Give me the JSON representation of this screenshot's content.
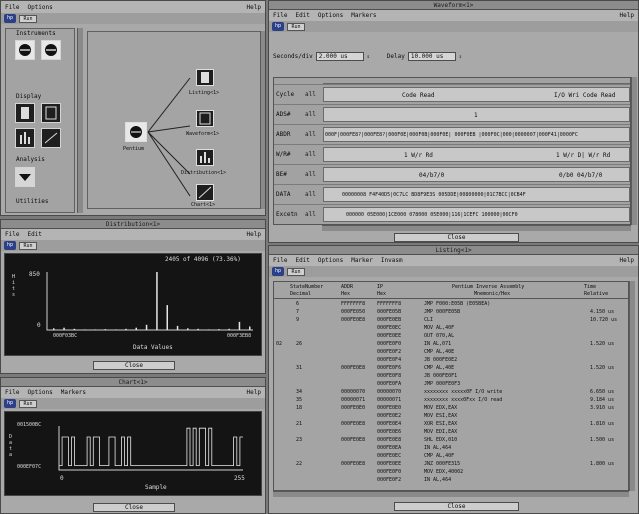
{
  "main": {
    "menu": [
      "File",
      "Options"
    ],
    "help": "Help",
    "run": "Run",
    "sections": [
      "Instruments",
      "Display",
      "Analysis",
      "Utilities"
    ],
    "center_node": "Pentium",
    "nodes": [
      "Listing<1>",
      "Waveform<1>",
      "Distribution<1>",
      "Chart<1>"
    ]
  },
  "waveform": {
    "title": "Waveform<1>",
    "menu": [
      "File",
      "Edit",
      "Options",
      "Markers"
    ],
    "help": "Help",
    "run": "Run",
    "sec_label": "Seconds/div",
    "sec_value": "2.000 us",
    "delay_label": "Delay",
    "delay_value": "10.000 us",
    "rows": [
      {
        "name": "Cycle",
        "all": "all",
        "text": "Code Read",
        "text2": "I/O Wri Code Read"
      },
      {
        "name": "ADS#",
        "all": "all",
        "text": "1",
        "text2": ""
      },
      {
        "name": "ABDR",
        "all": "all",
        "text": "000F|000FE8?|000FE8?|000F0E|000F0B|000F0E|   000F0EB   |000F0C|000|0000007|000F41|0000FC",
        "text2": ""
      },
      {
        "name": "W/R#",
        "all": "all",
        "text": "1  W/r  Rd",
        "text2": "1 W/r  D| W/r Rd"
      },
      {
        "name": "BE#",
        "all": "all",
        "text": "04/b7/0",
        "text2": "0/b0   04/b7/0"
      },
      {
        "name": "DATA",
        "all": "all",
        "text": "00000008    F4F40D5|0C7LC    BD8F9E3S    005DDE|00800000|01C7BCC|0CB4F",
        "text2": ""
      },
      {
        "name": "Excetn",
        "all": "all",
        "text": "000000   05E000|1CE000   078000   05E000|116|1CEFC  100000|00CF0",
        "text2": ""
      }
    ],
    "close": "Close"
  },
  "distribution": {
    "title": "Distribution<1>",
    "menu": [
      "File",
      "Edit"
    ],
    "help": "Help",
    "run": "Run",
    "summary": "2405 of 4096 (73.36%)",
    "ytick": "850",
    "yzero": "0",
    "ylabel": "Hits",
    "xmin": "000F03BC",
    "xmax": "000F3EB8",
    "xlabel": "Data Values",
    "close": "Close"
  },
  "chart": {
    "title": "Chart<1>",
    "menu": [
      "File",
      "Options",
      "Markers"
    ],
    "help": "Help",
    "run": "Run",
    "ytop": "001500BC",
    "ybottom": "000EF07C",
    "ylabel": "Data",
    "xmin": "0",
    "xmax": "255",
    "xlabel": "Sample",
    "close": "Close"
  },
  "listing": {
    "title": "Listing<1>",
    "menu": [
      "File",
      "Edit",
      "Options",
      "Marker",
      "Invasm"
    ],
    "help": "Help",
    "run": "Run",
    "headers": {
      "state": "StateNumber",
      "state2": "Decimal",
      "addr": "ADDR",
      "addr2": "Hex",
      "ip": "IP",
      "ip2": "Hex",
      "inv": "Pentium Inverse Assembly",
      "inv2": "Mnemonic/Hex",
      "time": "Time",
      "time2": "Relative"
    },
    "rows": [
      {
        "m": "",
        "n": "6",
        "a": "FFFFFFF8",
        "i": "FFFFFFF8",
        "x": "JMP    F000:E05B (E05BEA)",
        "t": ""
      },
      {
        "m": "",
        "n": "7",
        "a": "000FE050",
        "i": "000FE05B",
        "x": "JMP    000FE05B",
        "t": "4.150 us"
      },
      {
        "m": "",
        "n": "9",
        "a": "000FE0E8",
        "i": "000FE0EB",
        "x": "CLI",
        "t": "10.720 us"
      },
      {
        "m": "",
        "n": "",
        "a": "",
        "i": "000FE0EC",
        "x": "MOV    AL,40F",
        "t": ""
      },
      {
        "m": "",
        "n": "",
        "a": "",
        "i": "000FE0EE",
        "x": "OUT    070,AL",
        "t": ""
      },
      {
        "m": "02",
        "n": "26",
        "a": "",
        "i": "000FE0F0",
        "x": "IN     AL,071",
        "t": "1.520 us"
      },
      {
        "m": "",
        "n": "",
        "a": "",
        "i": "000FE0F2",
        "x": "CMP    AL,40E",
        "t": ""
      },
      {
        "m": "",
        "n": "",
        "a": "",
        "i": "000FE0F4",
        "x": "JB     000FE0E2",
        "t": ""
      },
      {
        "m": "",
        "n": "31",
        "a": "000FE0E8",
        "i": "000FE0F6",
        "x": "CMP    AL,40E",
        "t": "1.520 us"
      },
      {
        "m": "",
        "n": "",
        "a": "",
        "i": "000FE0F8",
        "x": "JB     000FE0F1",
        "t": ""
      },
      {
        "m": "",
        "n": "",
        "a": "",
        "i": "000FE0FA",
        "x": "JMP    000FE0F3",
        "t": ""
      },
      {
        "m": "",
        "n": "34",
        "a": "00000070",
        "i": "00000070",
        "x": "xxxxxxxx xxxxx0F I/O write",
        "t": "6.650 us"
      },
      {
        "m": "",
        "n": "35",
        "a": "00000071",
        "i": "00000071",
        "x": "xxxxxxxx xxxx0Fxx I/O read",
        "t": "9.184 us"
      },
      {
        "m": "",
        "n": "18",
        "a": "000FE0E0",
        "i": "000FE0E0",
        "x": "MOV    EDX,EAX",
        "t": "3.910 us"
      },
      {
        "m": "",
        "n": "",
        "a": "",
        "i": "000FE0E2",
        "x": "MOV    ESI,EAX",
        "t": ""
      },
      {
        "m": "",
        "n": "21",
        "a": "000FE0E8",
        "i": "000FE0E4",
        "x": "XOR    ESI,EAX",
        "t": "1.810 us"
      },
      {
        "m": "",
        "n": "",
        "a": "",
        "i": "000FE0E6",
        "x": "MOV    EDI,EAX",
        "t": ""
      },
      {
        "m": "",
        "n": "23",
        "a": "000FE0E8",
        "i": "000FE0E8",
        "x": "SHL    EDX,010",
        "t": "1.500 us"
      },
      {
        "m": "",
        "n": "",
        "a": "",
        "i": "000FE0EA",
        "x": "IN     AL,464",
        "t": ""
      },
      {
        "m": "",
        "n": "",
        "a": "",
        "i": "000FE0EC",
        "x": "CMP    AL,40F",
        "t": ""
      },
      {
        "m": "",
        "n": "22",
        "a": "000FE0E8",
        "i": "000FE0EE",
        "x": "JNZ    000FE315",
        "t": "1.800 us"
      },
      {
        "m": "",
        "n": "",
        "a": "",
        "i": "000FE0F0",
        "x": "MOV    EDX,40002",
        "t": ""
      },
      {
        "m": "",
        "n": "",
        "a": "",
        "i": "000FE0F2",
        "x": "IN     AL,464",
        "t": ""
      }
    ],
    "close": "Close"
  },
  "chart_data": [
    {
      "type": "bar",
      "title": "2405 of 4096 (73.36%)",
      "xlabel": "Data Values",
      "ylabel": "Hits",
      "ylim": [
        0,
        850
      ],
      "x": [
        0,
        1,
        2,
        3,
        4,
        5,
        6,
        7,
        8,
        9,
        10,
        11,
        12,
        13,
        14,
        15,
        16,
        17,
        18,
        19
      ],
      "values": [
        30,
        40,
        20,
        10,
        10,
        15,
        10,
        20,
        40,
        90,
        1000,
        430,
        70,
        30,
        20,
        10,
        15,
        20,
        140,
        60
      ]
    },
    {
      "type": "line",
      "xlabel": "Sample",
      "ylabel": "Data",
      "series": [
        {
          "values": [
            10,
            75,
            75,
            10,
            75,
            10,
            10,
            10,
            10,
            75,
            10,
            75,
            75,
            10,
            10,
            10,
            75,
            75,
            10,
            10,
            75,
            10,
            75,
            10,
            10,
            10,
            10,
            10,
            10,
            10,
            10,
            10,
            10,
            10,
            10,
            10,
            10,
            10,
            10,
            10,
            10,
            95,
            10,
            95,
            10,
            95,
            95,
            10,
            95,
            10,
            10,
            10,
            10,
            10,
            10,
            10,
            75,
            10,
            75,
            75
          ]
        }
      ]
    }
  ]
}
